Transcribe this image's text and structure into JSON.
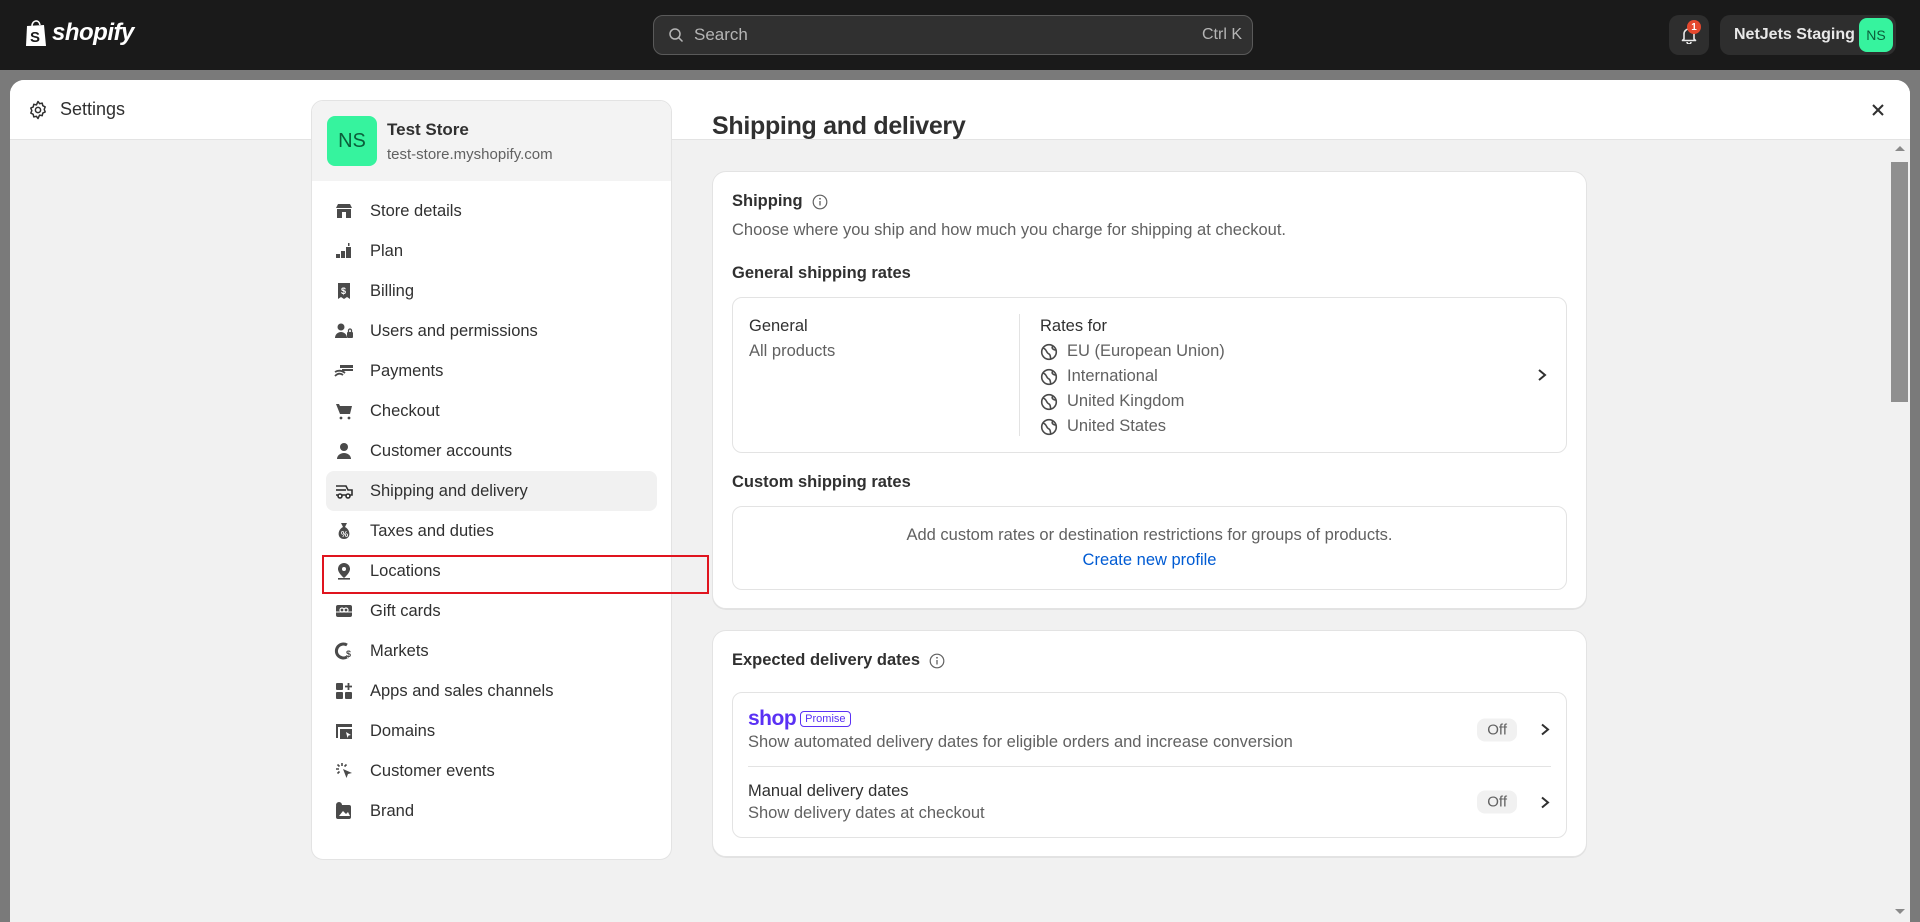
{
  "topbar": {
    "brand": "shopify",
    "search_placeholder": "Search",
    "search_shortcut": "Ctrl K",
    "notification_count": "1",
    "account_name": "NetJets Staging",
    "account_initials": "NS"
  },
  "modal": {
    "title": "Settings",
    "close_icon": "close-icon"
  },
  "store": {
    "initials": "NS",
    "name": "Test Store",
    "url": "test-store.myshopify.com"
  },
  "sidebar": {
    "active": "Shipping and delivery",
    "items": [
      {
        "label": "Store details",
        "icon": "store-icon"
      },
      {
        "label": "Plan",
        "icon": "plan-icon"
      },
      {
        "label": "Billing",
        "icon": "billing-icon"
      },
      {
        "label": "Users and permissions",
        "icon": "users-icon"
      },
      {
        "label": "Payments",
        "icon": "payments-icon"
      },
      {
        "label": "Checkout",
        "icon": "cart-icon"
      },
      {
        "label": "Customer accounts",
        "icon": "person-icon"
      },
      {
        "label": "Shipping and delivery",
        "icon": "truck-icon"
      },
      {
        "label": "Taxes and duties",
        "icon": "money-bag-icon"
      },
      {
        "label": "Locations",
        "icon": "location-pin-icon"
      },
      {
        "label": "Gift cards",
        "icon": "gift-card-icon"
      },
      {
        "label": "Markets",
        "icon": "globe-dollar-icon"
      },
      {
        "label": "Apps and sales channels",
        "icon": "apps-icon"
      },
      {
        "label": "Domains",
        "icon": "domains-icon"
      },
      {
        "label": "Customer events",
        "icon": "cursor-click-icon"
      },
      {
        "label": "Brand",
        "icon": "brand-image-icon"
      }
    ]
  },
  "main": {
    "page_title": "Shipping and delivery",
    "shipping": {
      "title": "Shipping",
      "description": "Choose where you ship and how much you charge for shipping at checkout.",
      "general_heading": "General shipping rates",
      "general_profile": {
        "name": "General",
        "products": "All products",
        "rates_for_label": "Rates for",
        "zones": [
          "EU (European Union)",
          "International",
          "United Kingdom",
          "United States"
        ]
      },
      "custom_heading": "Custom shipping rates",
      "custom_text": "Add custom rates or destination restrictions for groups of products.",
      "custom_link": "Create new profile"
    },
    "delivery_dates": {
      "title": "Expected delivery dates",
      "shop_promise": {
        "brand": "shop",
        "badge": "Promise",
        "description": "Show automated delivery dates for eligible orders and increase conversion",
        "status": "Off"
      },
      "manual": {
        "title": "Manual delivery dates",
        "description": "Show delivery dates at checkout",
        "status": "Off"
      }
    }
  },
  "colors": {
    "topbar_bg": "#1a1a1a",
    "avatar_green": "#36f39e",
    "link_blue": "#005bd3",
    "shop_purple": "#5a31f4",
    "highlight_red": "#e0141e",
    "badge_red": "#e5482e"
  }
}
